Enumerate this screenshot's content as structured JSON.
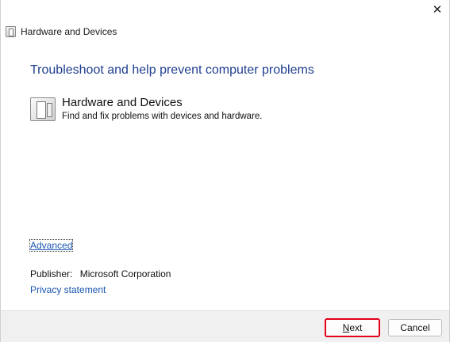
{
  "window": {
    "title": "Hardware and Devices",
    "close_glyph": "✕"
  },
  "main": {
    "heading": "Troubleshoot and help prevent computer problems",
    "task": {
      "title": "Hardware and Devices",
      "description": "Find and fix problems with devices and hardware.",
      "icon": "hardware-devices-icon"
    },
    "advanced_link": "Advanced",
    "publisher_label": "Publisher:",
    "publisher_value": "Microsoft Corporation",
    "privacy_link": "Privacy statement"
  },
  "footer": {
    "next_first": "N",
    "next_rest": "ext",
    "cancel_label": "Cancel"
  }
}
